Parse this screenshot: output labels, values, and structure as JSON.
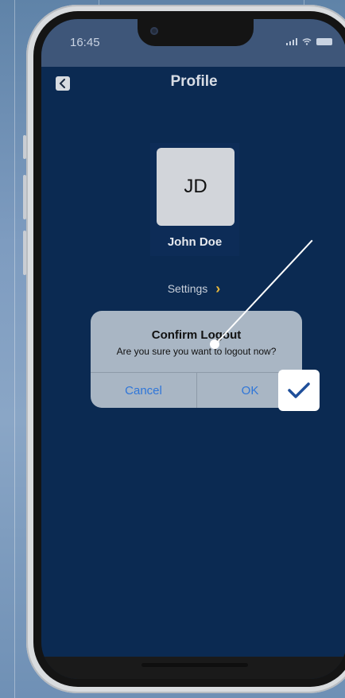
{
  "status_bar": {
    "time": "16:45",
    "battery_color": "#c9d3e2"
  },
  "header": {
    "title": "Profile",
    "back_icon": "chevron-left-icon"
  },
  "profile": {
    "initials": "JD",
    "name": "John Doe"
  },
  "settings": {
    "label": "Settings",
    "chevron_color": "#e8b83c"
  },
  "dialog": {
    "title": "Confirm Logout",
    "message": "Are you sure you want to logout now?",
    "cancel_label": "Cancel",
    "ok_label": "OK",
    "button_color": "#2f76d9"
  },
  "annotation": {
    "badge_icon": "checkmark-icon",
    "badge_color": "#1f4f9a"
  },
  "colors": {
    "screen_bg": "#0b2a52",
    "status_bg": "#3e5679"
  }
}
